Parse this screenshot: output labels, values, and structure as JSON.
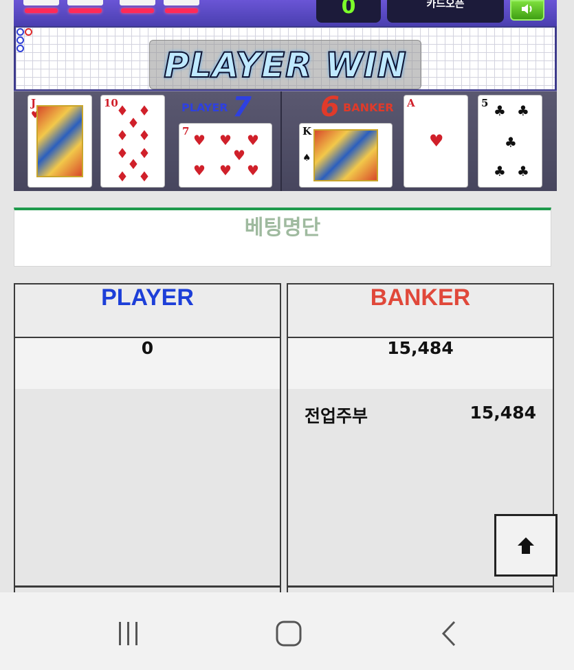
{
  "game": {
    "score": "0",
    "mode_label": "카드오픈",
    "sound_icon": "speaker-icon",
    "result_banner": "PLAYER WIN",
    "player": {
      "label": "PLAYER",
      "total": "7",
      "cards": [
        {
          "rank": "J",
          "suit": "♥"
        },
        {
          "rank": "10",
          "suit": "♦"
        },
        {
          "rank": "7",
          "suit": "♥"
        }
      ]
    },
    "banker": {
      "label": "BANKER",
      "total": "6",
      "cards": [
        {
          "rank": "K",
          "suit": "♠"
        },
        {
          "rank": "A",
          "suit": "♥"
        },
        {
          "rank": "5",
          "suit": "♣"
        }
      ]
    },
    "colors": {
      "player": "#2e40e0",
      "banker": "#e03a2a",
      "score": "#7cff2a"
    }
  },
  "betting": {
    "title": "베팅명단",
    "player": {
      "label": "PLAYER",
      "total": "0",
      "entries": []
    },
    "banker": {
      "label": "BANKER",
      "total": "15,484",
      "entries": [
        {
          "name": "전업주부",
          "amount": "15,484"
        }
      ]
    }
  },
  "scroll_top": {
    "icon": "arrow-up-icon"
  },
  "nav": {
    "recent_icon": "recent-apps-icon",
    "home_icon": "home-icon",
    "back_icon": "back-icon"
  }
}
